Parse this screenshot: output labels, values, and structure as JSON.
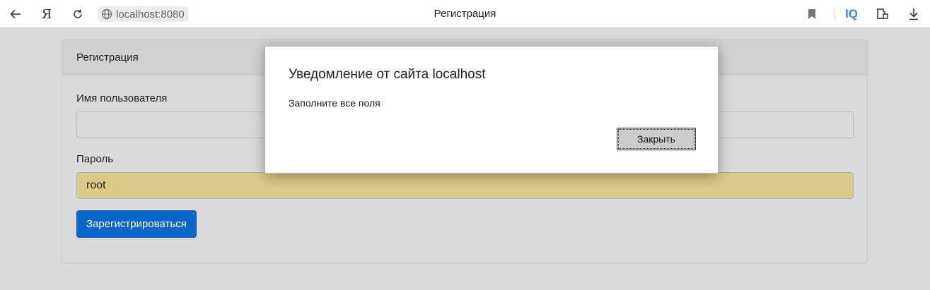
{
  "browser": {
    "url": "localhost:8080",
    "tab_title": "Регистрация",
    "ya_label": "Я",
    "iq_label": "IQ"
  },
  "card": {
    "header": "Регистрация",
    "username_label": "Имя пользователя",
    "username_value": "",
    "password_label": "Пароль",
    "password_value": "root",
    "submit_label": "Зарегистрироваться"
  },
  "dialog": {
    "title": "Уведомление от сайта localhost",
    "message": "Заполните все поля",
    "close_label": "Закрыть"
  },
  "colors": {
    "submit_bg": "#0a66c9",
    "autofill_bg": "#dccb88",
    "overlay_bg": "#dadada",
    "iq_accent": "#2f7ff5"
  },
  "icons": [
    "back-arrow-icon",
    "yandex-icon",
    "reload-icon",
    "globe-icon",
    "bookmark-icon",
    "iq-icon",
    "extensions-icon",
    "download-icon"
  ]
}
